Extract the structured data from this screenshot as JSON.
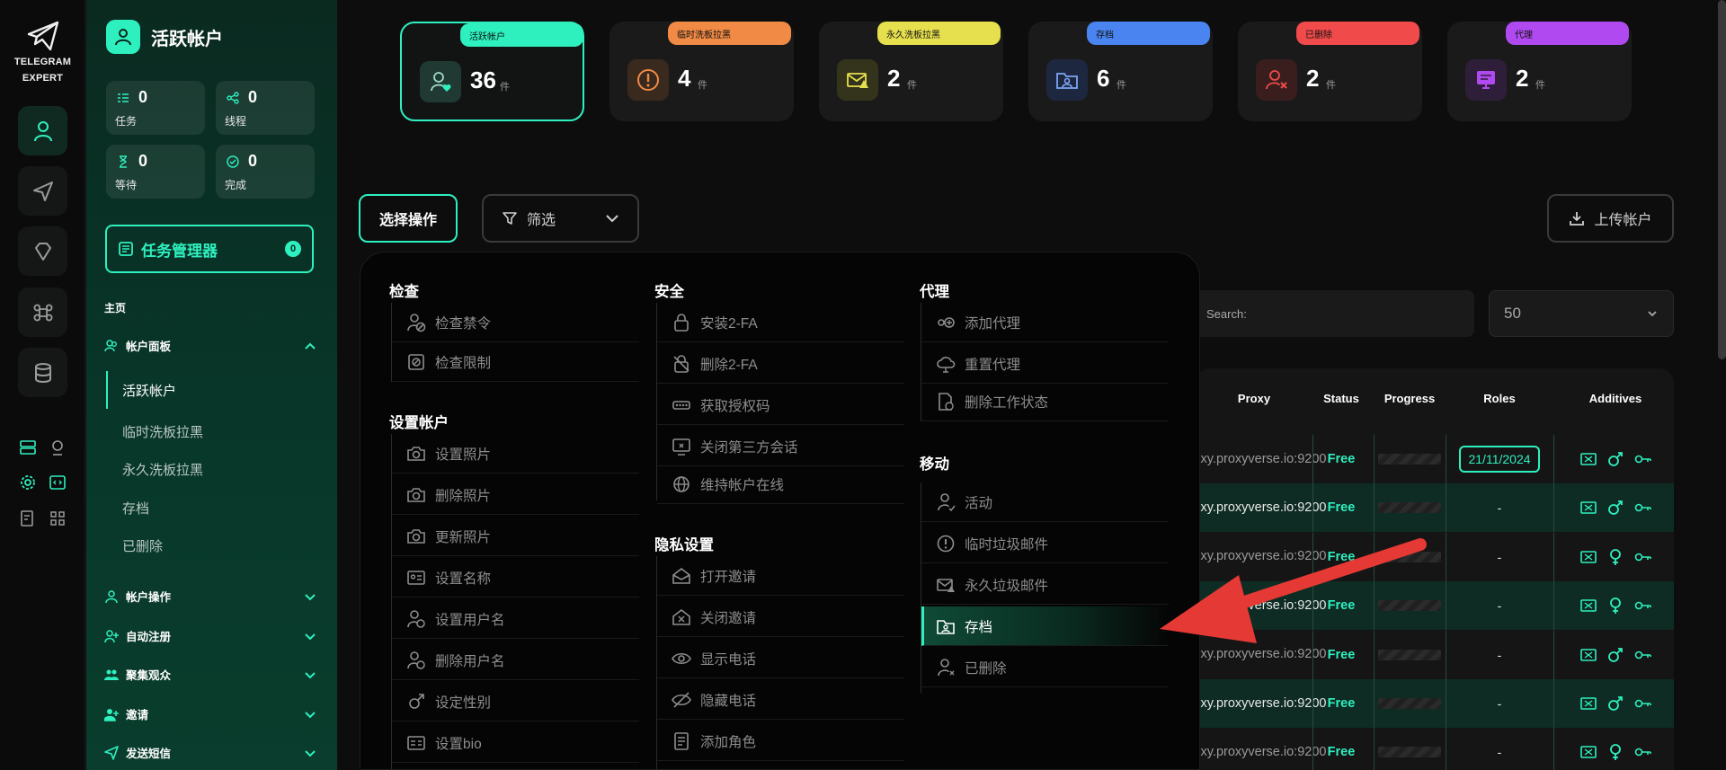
{
  "brand": {
    "line1": "TELEGRAM",
    "line2": "EXPERT"
  },
  "user": {
    "name": "活跃帐户"
  },
  "mini_stats": [
    {
      "label": "任务",
      "value": "0"
    },
    {
      "label": "线程",
      "value": "0"
    },
    {
      "label": "等待",
      "value": "0"
    },
    {
      "label": "完成",
      "value": "0"
    }
  ],
  "task_manager": {
    "label": "任务管理器",
    "count": "0"
  },
  "nav": {
    "home": "主页",
    "account_panel": "帐户面板",
    "sub": [
      "活跃帐户",
      "临时洗板拉黑",
      "永久洗板拉黑",
      "存档",
      "已删除"
    ],
    "sections": [
      "帐户操作",
      "自动注册",
      "聚集观众",
      "邀请",
      "发送短信"
    ]
  },
  "cards": [
    {
      "tag": "活跃帐户",
      "value": "36",
      "unit": "件",
      "color": "#2ef0bf"
    },
    {
      "tag": "临时洗板拉黑",
      "value": "4",
      "unit": "件",
      "color": "#f08a45"
    },
    {
      "tag": "永久洗板拉黑",
      "value": "2",
      "unit": "件",
      "color": "#e6e04e"
    },
    {
      "tag": "存档",
      "value": "6",
      "unit": "件",
      "color": "#4a84f0"
    },
    {
      "tag": "已删除",
      "value": "2",
      "unit": "件",
      "color": "#f04a4a"
    },
    {
      "tag": "代理",
      "value": "2",
      "unit": "件",
      "color": "#b04af0"
    }
  ],
  "toolbar": {
    "select_op": "选择操作",
    "filter": "筛选",
    "upload": "上传帐户"
  },
  "search": {
    "label": "Search:"
  },
  "per_page": {
    "value": "50"
  },
  "table": {
    "headers": [
      "Proxy",
      "Status",
      "Progress",
      "Roles",
      "Additives"
    ],
    "rows": [
      {
        "proxy1": "proxy.proxyvers",
        "proxy2": "e.io:9200",
        "status": "Free",
        "roles": "21/11/2024",
        "gender": "male"
      },
      {
        "proxy1": "proxy.proxyvers",
        "proxy2": "e.io:9200",
        "status": "Free",
        "roles": "-",
        "gender": "male"
      },
      {
        "proxy1": "proxy.proxyvers",
        "proxy2": "e.io:9200",
        "status": "Free",
        "roles": "-",
        "gender": "female"
      },
      {
        "proxy1": "proxy.proxyvers",
        "proxy2": "e.io:9200",
        "status": "Free",
        "roles": "-",
        "gender": "female"
      },
      {
        "proxy1": "proxy.proxyvers",
        "proxy2": "e.io:9200",
        "status": "Free",
        "roles": "-",
        "gender": "male"
      },
      {
        "proxy1": "proxy.proxyvers",
        "proxy2": "e.io:9200",
        "status": "Free",
        "roles": "-",
        "gender": "male"
      },
      {
        "proxy1": "proxy.proxyvers",
        "proxy2": "e.io:9200",
        "status": "Free",
        "roles": "-",
        "gender": "female"
      }
    ]
  },
  "menu": {
    "check": {
      "title": "检查",
      "items": [
        "检查禁令",
        "检查限制"
      ]
    },
    "setup": {
      "title": "设置帐户",
      "items": [
        "设置照片",
        "删除照片",
        "更新照片",
        "设置名称",
        "设置用户名",
        "删除用户名",
        "设定性别",
        "设置bio"
      ]
    },
    "security": {
      "title": "安全",
      "items": [
        "安装2-FA",
        "删除2-FA",
        "获取授权码",
        "关闭第三方会话",
        "维持帐户在线"
      ]
    },
    "privacy": {
      "title": "隐私设置",
      "items": [
        "打开邀请",
        "关闭邀请",
        "显示电话",
        "隐藏电话",
        "添加角色"
      ]
    },
    "proxy": {
      "title": "代理",
      "items": [
        "添加代理",
        "重置代理",
        "删除工作状态"
      ]
    },
    "move": {
      "title": "移动",
      "items": [
        "活动",
        "临时垃圾邮件",
        "永久垃圾邮件",
        "存档",
        "已删除"
      ]
    }
  }
}
